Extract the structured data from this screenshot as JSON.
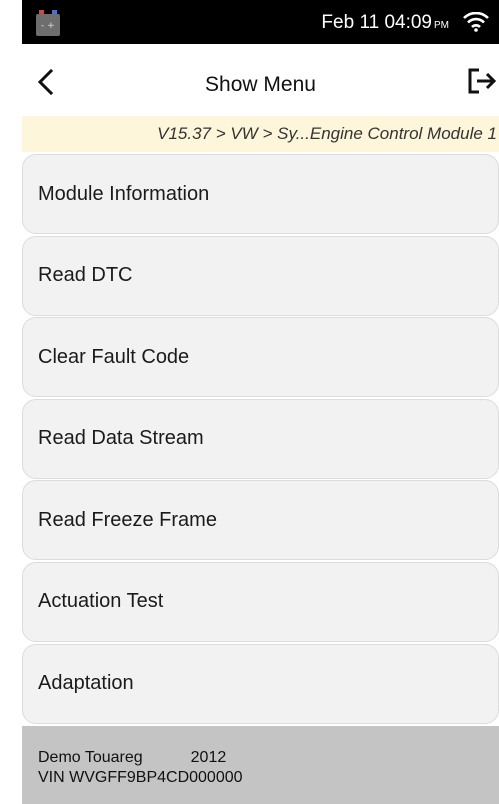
{
  "status_bar": {
    "date_time": "Feb 11 04:09",
    "ampm": "PM",
    "battery_icon": "vehicle-battery-icon",
    "wifi_icon": "wifi-icon"
  },
  "header": {
    "title": "Show Menu",
    "back_icon": "chevron-left-icon",
    "exit_icon": "exit-icon"
  },
  "breadcrumb": "V15.37 > VW > Sy...Engine Control Module 1",
  "menu": {
    "items": [
      {
        "label": "Module Information"
      },
      {
        "label": "Read DTC"
      },
      {
        "label": "Clear Fault Code"
      },
      {
        "label": "Read Data Stream"
      },
      {
        "label": "Read Freeze Frame"
      },
      {
        "label": "Actuation Test"
      },
      {
        "label": "Adaptation"
      }
    ]
  },
  "footer": {
    "vehicle": "Demo Touareg",
    "year": "2012",
    "vin": "VIN WVGFF9BP4CD000000"
  },
  "colors": {
    "breadcrumb_bg": "#fdf6db",
    "menu_item_bg": "#f2f2f2",
    "footer_bg": "#c4c4c4",
    "status_bar_bg": "#000000"
  }
}
